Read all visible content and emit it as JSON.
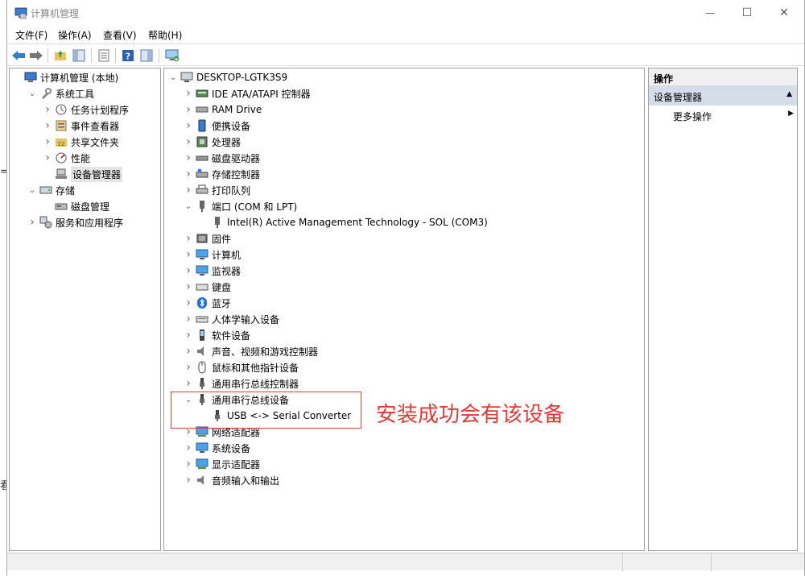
{
  "window": {
    "title": "计算机管理",
    "minimize": "—",
    "maximize": "☐",
    "close": "✕"
  },
  "menu": [
    "文件(F)",
    "操作(A)",
    "查看(V)",
    "帮助(H)"
  ],
  "edge_fragments": [
    "="
  ],
  "left_tree": [
    {
      "label": "计算机管理 (本地)",
      "caret": "",
      "icon": "computer-management-icon",
      "level": 0
    },
    {
      "label": "系统工具",
      "caret": "v",
      "icon": "system-tools-icon",
      "level": 1
    },
    {
      "label": "任务计划程序",
      "caret": ">",
      "icon": "task-scheduler-icon",
      "level": 2
    },
    {
      "label": "事件查看器",
      "caret": ">",
      "icon": "event-viewer-icon",
      "level": 2
    },
    {
      "label": "共享文件夹",
      "caret": ">",
      "icon": "shared-folders-icon",
      "level": 2
    },
    {
      "label": "性能",
      "caret": ">",
      "icon": "performance-icon",
      "level": 2
    },
    {
      "label": "设备管理器",
      "caret": "",
      "icon": "device-manager-icon",
      "level": 2,
      "selected": true
    },
    {
      "label": "存储",
      "caret": "v",
      "icon": "storage-icon",
      "level": 1
    },
    {
      "label": "磁盘管理",
      "caret": "",
      "icon": "disk-management-icon",
      "level": 2
    },
    {
      "label": "服务和应用程序",
      "caret": ">",
      "icon": "services-apps-icon",
      "level": 1
    }
  ],
  "device_tree": {
    "root": "DESKTOP-LGTK3S9",
    "items": [
      {
        "label": "IDE ATA/ATAPI 控制器",
        "caret": ">",
        "icon": "ide-controller-icon"
      },
      {
        "label": "RAM Drive",
        "caret": ">",
        "icon": "ram-drive-icon"
      },
      {
        "label": "便携设备",
        "caret": ">",
        "icon": "portable-device-icon"
      },
      {
        "label": "处理器",
        "caret": ">",
        "icon": "processor-icon"
      },
      {
        "label": "磁盘驱动器",
        "caret": ">",
        "icon": "disk-drive-icon"
      },
      {
        "label": "存储控制器",
        "caret": ">",
        "icon": "storage-controller-icon"
      },
      {
        "label": "打印队列",
        "caret": ">",
        "icon": "print-queue-icon"
      },
      {
        "label": "端口 (COM 和 LPT)",
        "caret": "v",
        "icon": "port-icon"
      },
      {
        "label": "Intel(R) Active Management Technology - SOL (COM3)",
        "caret": "",
        "icon": "port-device-icon",
        "child": true
      },
      {
        "label": "固件",
        "caret": ">",
        "icon": "firmware-icon"
      },
      {
        "label": "计算机",
        "caret": ">",
        "icon": "computer-icon"
      },
      {
        "label": "监视器",
        "caret": ">",
        "icon": "monitor-icon"
      },
      {
        "label": "键盘",
        "caret": ">",
        "icon": "keyboard-icon"
      },
      {
        "label": "蓝牙",
        "caret": ">",
        "icon": "bluetooth-icon"
      },
      {
        "label": "人体学输入设备",
        "caret": ">",
        "icon": "hid-icon"
      },
      {
        "label": "软件设备",
        "caret": ">",
        "icon": "software-device-icon"
      },
      {
        "label": "声音、视频和游戏控制器",
        "caret": ">",
        "icon": "sound-icon"
      },
      {
        "label": "鼠标和其他指针设备",
        "caret": ">",
        "icon": "mouse-icon"
      },
      {
        "label": "通用串行总线控制器",
        "caret": ">",
        "icon": "usb-controller-icon"
      },
      {
        "label": "通用串行总线设备",
        "caret": "v",
        "icon": "usb-device-icon"
      },
      {
        "label": "USB <-> Serial Converter",
        "caret": "",
        "icon": "usb-serial-icon",
        "child": true
      },
      {
        "label": "网络适配器",
        "caret": ">",
        "icon": "network-adapter-icon"
      },
      {
        "label": "系统设备",
        "caret": ">",
        "icon": "system-device-icon"
      },
      {
        "label": "显示适配器",
        "caret": ">",
        "icon": "display-adapter-icon"
      },
      {
        "label": "音频输入和输出",
        "caret": ">",
        "icon": "audio-io-icon"
      }
    ]
  },
  "actions": {
    "header": "操作",
    "section": "设备管理器",
    "section_arrow": "▲",
    "more": "更多操作",
    "more_arrow": "▶"
  },
  "annotation": {
    "text": "安装成功会有该设备",
    "color": "#e23a3a"
  },
  "colors": {
    "accent": "#d4dde9",
    "annotation": "#e23a3a"
  }
}
